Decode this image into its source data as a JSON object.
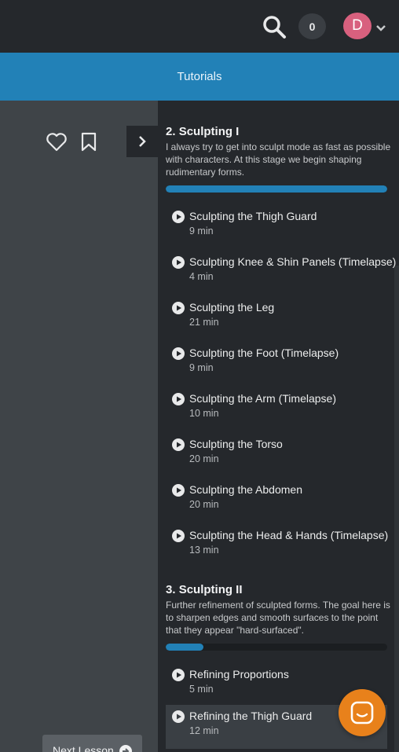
{
  "header": {
    "notification_count": "0",
    "avatar_initial": "D"
  },
  "tabbar": {
    "label": "Tutorials"
  },
  "left_pane": {
    "next_lesson_label": "Next Lesson"
  },
  "sections": [
    {
      "number": "2.",
      "title": "Sculpting I",
      "description": "I always try to get into sculpt mode as fast as possible with characters. At this stage we begin shaping rudimentary forms.",
      "progress": 1.0,
      "lessons": [
        {
          "title": "Sculpting the Thigh Guard",
          "duration": "9 min"
        },
        {
          "title": "Sculpting Knee & Shin Panels (Timelapse)",
          "duration": "4 min"
        },
        {
          "title": "Sculpting the Leg",
          "duration": "21 min"
        },
        {
          "title": "Sculpting the Foot (Timelapse)",
          "duration": "9 min"
        },
        {
          "title": "Sculpting the Arm (Timelapse)",
          "duration": "10 min"
        },
        {
          "title": "Sculpting the Torso",
          "duration": "20 min"
        },
        {
          "title": "Sculpting the Abdomen",
          "duration": "20 min"
        },
        {
          "title": "Sculpting the Head & Hands (Timelapse)",
          "duration": "13 min"
        }
      ]
    },
    {
      "number": "3.",
      "title": "Sculpting II",
      "description": "Further refinement of sculpted forms. The goal here is to sharpen edges and smooth surfaces to the point that they appear \"hard-surfaced\".",
      "progress": 0.17,
      "lessons": [
        {
          "title": "Refining Proportions",
          "duration": "5 min"
        },
        {
          "title": "Refining the Thigh Guard",
          "duration": "12 min",
          "active": true
        }
      ]
    }
  ],
  "colors": {
    "accent": "#2281b7",
    "chat": "#e8811b",
    "avatar": "#d8607e"
  },
  "icons": [
    "search-icon",
    "heart-icon",
    "bookmark-icon",
    "chevron-right-icon",
    "chevron-down-icon",
    "play-icon",
    "arrow-right-circle-icon",
    "chat-icon"
  ]
}
